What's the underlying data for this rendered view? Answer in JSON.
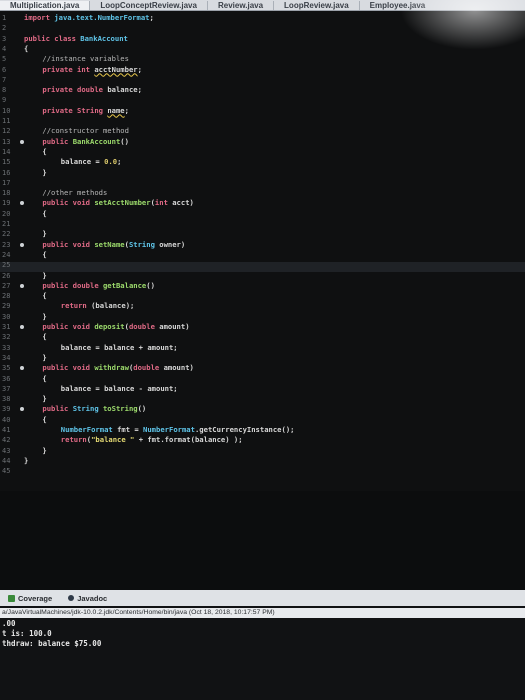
{
  "tabs": [
    "Multiplication.java",
    "LoopConceptReview.java",
    "Review.java",
    "LoopReview.java",
    "Employee.java"
  ],
  "code_lines": [
    {
      "n": "1",
      "bp": false,
      "indent": 0,
      "tokens": [
        [
          "kw",
          "import "
        ],
        [
          "cls",
          "java.text.NumberFormat"
        ],
        [
          "",
          "; "
        ]
      ]
    },
    {
      "n": "2",
      "bp": false,
      "indent": 0,
      "tokens": []
    },
    {
      "n": "3",
      "bp": false,
      "indent": 0,
      "tokens": [
        [
          "kw",
          "public class "
        ],
        [
          "cls",
          "BankAccount"
        ]
      ]
    },
    {
      "n": "4",
      "bp": false,
      "indent": 0,
      "tokens": [
        [
          "",
          "{"
        ]
      ]
    },
    {
      "n": "5",
      "bp": false,
      "indent": 2,
      "tokens": [
        [
          "cmt",
          "//instance variables"
        ]
      ]
    },
    {
      "n": "6",
      "bp": false,
      "indent": 2,
      "tokens": [
        [
          "kw",
          "private int "
        ],
        [
          "err",
          "acctNumber"
        ],
        [
          "",
          ";"
        ]
      ]
    },
    {
      "n": "7",
      "bp": false,
      "indent": 0,
      "tokens": []
    },
    {
      "n": "8",
      "bp": false,
      "indent": 2,
      "tokens": [
        [
          "kw",
          "private double "
        ],
        [
          "",
          "balance;"
        ]
      ]
    },
    {
      "n": "9",
      "bp": false,
      "indent": 0,
      "tokens": []
    },
    {
      "n": "10",
      "bp": false,
      "indent": 2,
      "tokens": [
        [
          "kw",
          "private String "
        ],
        [
          "err",
          "name"
        ],
        [
          "",
          ";"
        ]
      ]
    },
    {
      "n": "11",
      "bp": false,
      "indent": 0,
      "tokens": []
    },
    {
      "n": "12",
      "bp": false,
      "indent": 2,
      "tokens": [
        [
          "cmt",
          "//constructor method"
        ]
      ]
    },
    {
      "n": "13",
      "bp": true,
      "indent": 2,
      "tokens": [
        [
          "kw",
          "public "
        ],
        [
          "fn",
          "BankAccount"
        ],
        [
          "",
          "()"
        ]
      ]
    },
    {
      "n": "14",
      "bp": false,
      "indent": 2,
      "tokens": [
        [
          "",
          "{"
        ]
      ]
    },
    {
      "n": "15",
      "bp": false,
      "indent": 4,
      "tokens": [
        [
          "",
          "balance = "
        ],
        [
          "num",
          "0.0"
        ],
        [
          "",
          ";"
        ]
      ]
    },
    {
      "n": "16",
      "bp": false,
      "indent": 2,
      "tokens": [
        [
          "",
          "}"
        ]
      ]
    },
    {
      "n": "17",
      "bp": false,
      "indent": 0,
      "tokens": []
    },
    {
      "n": "18",
      "bp": false,
      "indent": 2,
      "tokens": [
        [
          "cmt",
          "//other methods"
        ]
      ]
    },
    {
      "n": "19",
      "bp": true,
      "indent": 2,
      "tokens": [
        [
          "kw",
          "public void "
        ],
        [
          "fn",
          "setAcctNumber"
        ],
        [
          "",
          "("
        ],
        [
          "kw",
          "int "
        ],
        [
          "",
          "acct)"
        ]
      ]
    },
    {
      "n": "20",
      "bp": false,
      "indent": 2,
      "tokens": [
        [
          "",
          "{"
        ]
      ]
    },
    {
      "n": "21",
      "bp": false,
      "indent": 0,
      "tokens": []
    },
    {
      "n": "22",
      "bp": false,
      "indent": 2,
      "tokens": [
        [
          "",
          "}"
        ]
      ]
    },
    {
      "n": "23",
      "bp": true,
      "indent": 2,
      "tokens": [
        [
          "kw",
          "public void "
        ],
        [
          "fn",
          "setName"
        ],
        [
          "",
          "("
        ],
        [
          "cls",
          "String "
        ],
        [
          "",
          "owner)"
        ]
      ]
    },
    {
      "n": "24",
      "bp": false,
      "indent": 2,
      "tokens": [
        [
          "",
          "{"
        ]
      ]
    },
    {
      "n": "25",
      "bp": false,
      "indent": 0,
      "tokens": []
    },
    {
      "n": "26",
      "bp": false,
      "indent": 2,
      "tokens": [
        [
          "",
          "}"
        ]
      ]
    },
    {
      "n": "27",
      "bp": true,
      "indent": 2,
      "tokens": [
        [
          "kw",
          "public double "
        ],
        [
          "fn",
          "getBalance"
        ],
        [
          "",
          "()"
        ]
      ]
    },
    {
      "n": "28",
      "bp": false,
      "indent": 2,
      "tokens": [
        [
          "",
          "{"
        ]
      ]
    },
    {
      "n": "29",
      "bp": false,
      "indent": 4,
      "tokens": [
        [
          "kw",
          "return "
        ],
        [
          "",
          "(balance);"
        ]
      ]
    },
    {
      "n": "30",
      "bp": false,
      "indent": 2,
      "tokens": [
        [
          "",
          "}"
        ]
      ]
    },
    {
      "n": "31",
      "bp": true,
      "indent": 2,
      "tokens": [
        [
          "kw",
          "public void "
        ],
        [
          "fn",
          "deposit"
        ],
        [
          "",
          "("
        ],
        [
          "kw",
          "double "
        ],
        [
          "",
          "amount)"
        ]
      ]
    },
    {
      "n": "32",
      "bp": false,
      "indent": 2,
      "tokens": [
        [
          "",
          "{"
        ]
      ]
    },
    {
      "n": "33",
      "bp": false,
      "indent": 4,
      "tokens": [
        [
          "",
          "balance = balance + amount;"
        ]
      ]
    },
    {
      "n": "34",
      "bp": false,
      "indent": 2,
      "tokens": [
        [
          "",
          "}"
        ]
      ]
    },
    {
      "n": "35",
      "bp": true,
      "indent": 2,
      "tokens": [
        [
          "kw",
          "public void "
        ],
        [
          "fn",
          "withdraw"
        ],
        [
          "",
          "("
        ],
        [
          "kw",
          "double "
        ],
        [
          "",
          "amount)"
        ]
      ]
    },
    {
      "n": "36",
      "bp": false,
      "indent": 2,
      "tokens": [
        [
          "",
          "{"
        ]
      ]
    },
    {
      "n": "37",
      "bp": false,
      "indent": 4,
      "tokens": [
        [
          "",
          "balance = balance - amount;"
        ]
      ]
    },
    {
      "n": "38",
      "bp": false,
      "indent": 2,
      "tokens": [
        [
          "",
          "}"
        ]
      ]
    },
    {
      "n": "39",
      "bp": true,
      "indent": 2,
      "tokens": [
        [
          "kw",
          "public "
        ],
        [
          "cls",
          "String "
        ],
        [
          "fn",
          "toString"
        ],
        [
          "",
          "()"
        ]
      ]
    },
    {
      "n": "40",
      "bp": false,
      "indent": 2,
      "tokens": [
        [
          "",
          "{"
        ]
      ]
    },
    {
      "n": "41",
      "bp": false,
      "indent": 4,
      "tokens": [
        [
          "cls",
          "NumberFormat "
        ],
        [
          "",
          "fmt = "
        ],
        [
          "cls",
          "NumberFormat"
        ],
        [
          "",
          ".getCurrencyInstance();"
        ]
      ]
    },
    {
      "n": "42",
      "bp": false,
      "indent": 4,
      "tokens": [
        [
          "kw",
          "return"
        ],
        [
          "",
          "("
        ],
        [
          "str",
          "\"balance \""
        ],
        [
          "",
          " + fmt.format(balance) );"
        ]
      ]
    },
    {
      "n": "43",
      "bp": false,
      "indent": 2,
      "tokens": [
        [
          "",
          "}"
        ]
      ]
    },
    {
      "n": "44",
      "bp": false,
      "indent": 0,
      "tokens": [
        [
          "",
          "}"
        ]
      ]
    },
    {
      "n": "45",
      "bp": false,
      "indent": 0,
      "tokens": []
    }
  ],
  "panel": {
    "tab_coverage": "Coverage",
    "tab_javadoc": "Javadoc",
    "console_path": "a/JavaVirtualMachines/jdk-10.0.2.jdk/Contents/Home/bin/java (Oct 18, 2018, 10:17:57 PM)",
    "output": [
      ".00",
      "t is: 100.0",
      "thdraw: balance $75.00"
    ]
  }
}
